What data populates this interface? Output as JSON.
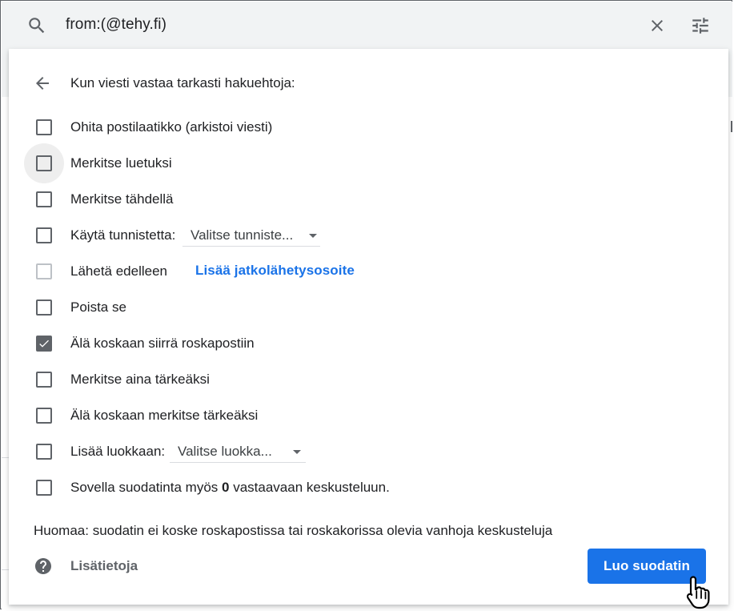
{
  "search": {
    "query": "from:(@tehy.fi)",
    "search_icon": "search-icon",
    "clear_icon": "close-icon",
    "options_icon": "tune-icon"
  },
  "dialog": {
    "title": "Kun viesti vastaa tarkasti hakuehtoja:",
    "back_icon": "arrow-back-icon",
    "options": [
      {
        "label": "Ohita postilaatikko (arkistoi viesti)",
        "checked": false
      },
      {
        "label": "Merkitse luetuksi",
        "checked": false,
        "hovered": true
      },
      {
        "label": "Merkitse tähdellä",
        "checked": false
      },
      {
        "label": "Käytä tunnistetta:",
        "checked": false,
        "dropdown": "Valitse tunniste..."
      },
      {
        "label": "Lähetä edelleen",
        "checked": false,
        "disabled": true,
        "link": "Lisää jatkolähetysosoite"
      },
      {
        "label": "Poista se",
        "checked": false
      },
      {
        "label": "Älä koskaan siirrä roskapostiin",
        "checked": true
      },
      {
        "label": "Merkitse aina tärkeäksi",
        "checked": false
      },
      {
        "label": "Älä koskaan merkitse tärkeäksi",
        "checked": false
      },
      {
        "label": "Lisää luokkaan:",
        "checked": false,
        "dropdown": "Valitse luokka..."
      },
      {
        "label_prefix": "Sovella suodatinta myös ",
        "label_count": "0",
        "label_suffix": " vastaavaan keskusteluun.",
        "checked": false
      }
    ],
    "note": "Huomaa: suodatin ei koske roskapostissa tai roskakorissa olevia vanhoja keskusteluja",
    "help_label": "Lisätietoja",
    "help_icon": "help-icon",
    "create_button": "Luo suodatin"
  },
  "colors": {
    "accent": "#1a73e8",
    "icon": "#5f6368",
    "text": "#202124",
    "search_bg": "#f1f3f4"
  }
}
